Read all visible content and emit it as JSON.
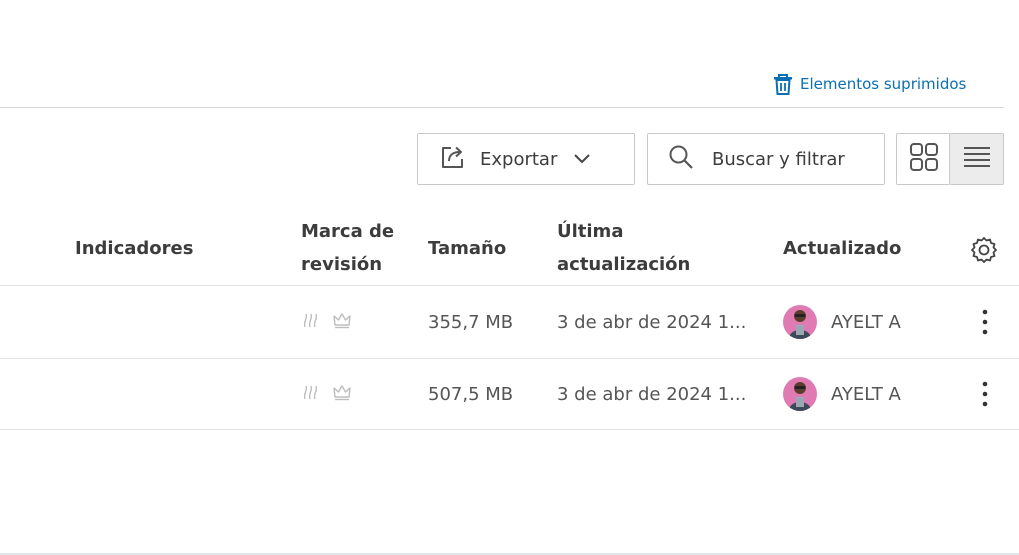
{
  "header": {
    "deleted_items_label": "Elementos suprimidos"
  },
  "toolbar": {
    "export_label": "Exportar",
    "search_filter_label": "Buscar y filtrar",
    "view_modes": [
      "grid",
      "list"
    ],
    "active_view": "list"
  },
  "table": {
    "columns": {
      "indicators": "Indicadores",
      "revision_mark_line1": "Marca de",
      "revision_mark_line2": "revisión",
      "size": "Tamaño",
      "last_update_line1": "Última",
      "last_update_line2": "actualización",
      "updated_by": "Actualizado"
    },
    "rows": [
      {
        "size": "355,7 MB",
        "last_update": "3 de abr de 2024 1...",
        "updated_by": "AYELT A"
      },
      {
        "size": "507,5 MB",
        "last_update": "3 de abr de 2024 1...",
        "updated_by": "AYELT A"
      }
    ]
  },
  "colors": {
    "link": "#0a6fb4",
    "avatar_bg": "#e07ab3",
    "active_view_bg": "#ececec"
  },
  "icons": [
    "trash-icon",
    "export-icon",
    "chevron-down-icon",
    "search-icon",
    "grid-view-icon",
    "list-view-icon",
    "settings-gear-icon",
    "revision-mark-icon",
    "crown-icon",
    "more-vertical-icon"
  ]
}
